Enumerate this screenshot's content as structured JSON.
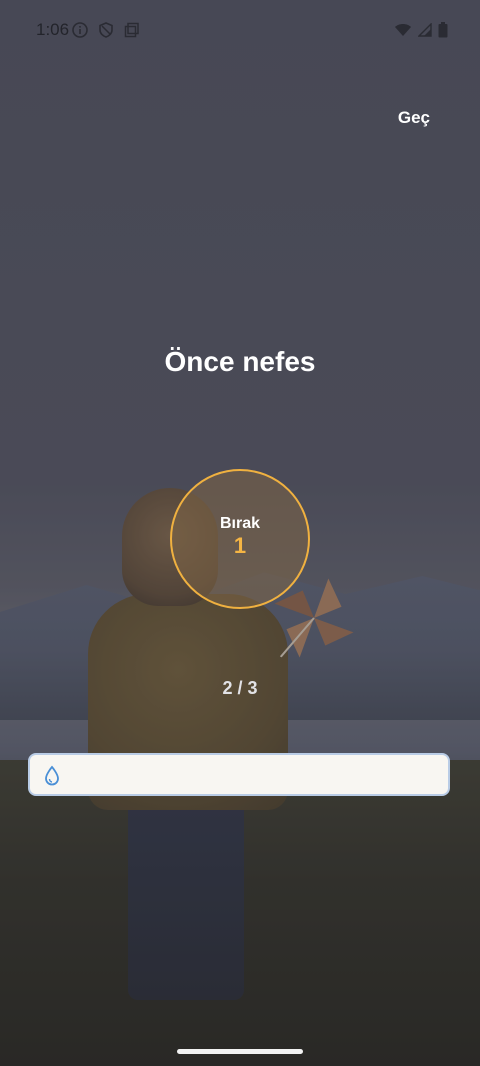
{
  "status_bar": {
    "time": "1:06"
  },
  "header": {
    "skip_label": "Geç"
  },
  "main": {
    "title": "Önce nefes",
    "phase_label": "Bırak",
    "phase_count": "1",
    "cycle_counter": "2 / 3"
  },
  "input": {
    "value": "",
    "icon": "drop-icon"
  },
  "colors": {
    "accent": "#f0b140",
    "input_border": "#b9cce6",
    "input_icon": "#4a8fd6"
  }
}
